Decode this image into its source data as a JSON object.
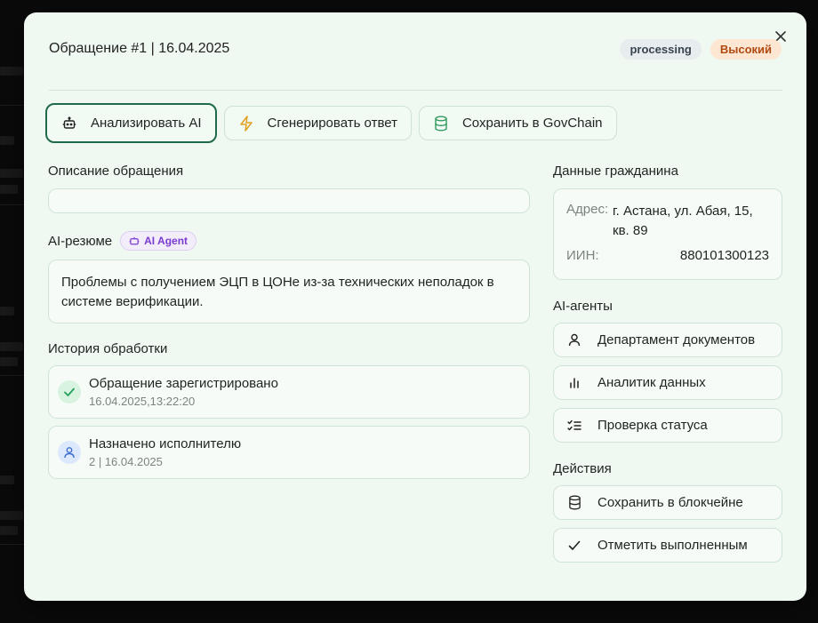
{
  "modal": {
    "title": "Обращение #1 | 16.04.2025",
    "status_badge": "processing",
    "priority_badge": "Высокий"
  },
  "toolbar": {
    "analyze_label": "Анализировать AI",
    "generate_label": "Сгенерировать ответ",
    "govchain_label": "Сохранить в GovChain"
  },
  "description": {
    "title": "Описание обращения",
    "text": ""
  },
  "summary": {
    "title": "AI-резюме",
    "agent_badge": "AI Agent",
    "text": "Проблемы с получением ЭЦП в ЦОНе из-за технических неполадок в системе верификации."
  },
  "history": {
    "title": "История обработки",
    "items": [
      {
        "title": "Обращение зарегистрировано",
        "sub": "16.04.2025,13:22:20",
        "icon": "check-icon"
      },
      {
        "title": "Назначено исполнителю",
        "sub": "2 | 16.04.2025",
        "icon": "user-icon"
      }
    ]
  },
  "citizen": {
    "title": "Данные гражданина",
    "address_label": "Адрес:",
    "address_value": "г. Астана, ул. Абая, 15, кв. 89",
    "inn_label": "ИИН:",
    "inn_value": "880101300123"
  },
  "agents": {
    "title": "AI-агенты",
    "items": [
      {
        "label": "Департамент документов",
        "icon": "user-icon"
      },
      {
        "label": "Аналитик данных",
        "icon": "bar-chart-icon"
      },
      {
        "label": "Проверка статуса",
        "icon": "checklist-icon"
      }
    ]
  },
  "actions": {
    "title": "Действия",
    "items": [
      {
        "label": "Сохранить в блокчейне",
        "icon": "database-icon"
      },
      {
        "label": "Отметить выполненным",
        "icon": "check-icon"
      }
    ]
  },
  "colors": {
    "modal_bg": "#f0f8f2",
    "accent": "#1f6b48",
    "priority_text": "#b04a12",
    "agent_badge_text": "#7a3bd0"
  }
}
